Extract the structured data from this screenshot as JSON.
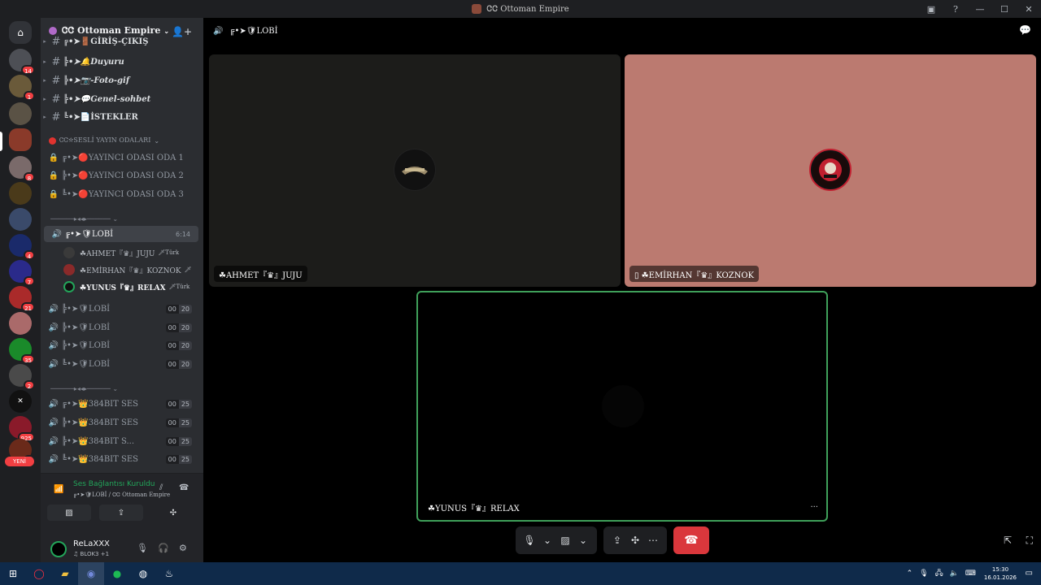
{
  "window": {
    "title": "ᏣᏣ Ottoman Empire",
    "controls": [
      "—",
      "☐",
      "✕"
    ]
  },
  "servers": {
    "badges": [
      "14",
      "1",
      "8",
      "4",
      "7",
      "21",
      "35",
      "2",
      "925",
      "1"
    ],
    "new_label": "YENİ"
  },
  "guild": {
    "name": "ᏣᏣ Ottoman Empire"
  },
  "text_channels": [
    {
      "name": "╔•➤🚪GİRİŞ-ÇIKIŞ"
    },
    {
      "name": "╠•➤🔔Duyuru"
    },
    {
      "name": "╠•➤📷-Foto-gif"
    },
    {
      "name": "╠•➤💬Genel-sohbet"
    },
    {
      "name": "╚•➤📄İSTEKLER"
    }
  ],
  "category_yayin": {
    "name": "ᏣᏣ☆SESLİ YAYIN ODALARI"
  },
  "yayin_channels": [
    {
      "name": "╔•➤🔴YAYINCI ODASI ODA 1"
    },
    {
      "name": "╠•➤🔴YAYINCI ODASI ODA 2"
    },
    {
      "name": "╚•➤🔴YAYINCI ODASI ODA 3"
    }
  ],
  "separator_1": "──────▸◂◂▸────── ⌄",
  "active_channel": {
    "name": "╔•➤🛡LOBİ",
    "timer": "6:14"
  },
  "members": [
    {
      "name": "☘AHMET『♛』JUJU",
      "flag": "🗡Türk"
    },
    {
      "name": "☘EMİRHAN『♛』KOZNOK",
      "flag": "🗡"
    },
    {
      "name": "☘YUNUS『♛』RELAX",
      "flag": "🗡Türk"
    }
  ],
  "lobi_channels": [
    {
      "name": "╠•➤🛡LOBİ",
      "count": "00",
      "limit": "20"
    },
    {
      "name": "╠•➤🛡LOBİ",
      "count": "00",
      "limit": "20"
    },
    {
      "name": "╠•➤🛡LOBİ",
      "count": "00",
      "limit": "20"
    },
    {
      "name": "╚•➤🛡LOBİ",
      "count": "00",
      "limit": "20"
    }
  ],
  "separator_2": "──────▸◂◂▸────── ⌄",
  "bit_channels": [
    {
      "name": "╔•➤👑384BIT SES",
      "count": "00",
      "limit": "25"
    },
    {
      "name": "╠•➤👑384BIT SES",
      "count": "00",
      "limit": "25"
    },
    {
      "name": "╠•➤👑384BIT S...",
      "count": "00",
      "limit": "25"
    },
    {
      "name": "╚•➤👑384BIT SES",
      "count": "00",
      "limit": "25"
    }
  ],
  "voice_panel": {
    "status": "Ses Bağlantısı Kuruldu",
    "location": "╔•➤🛡LOBİ / ᏣᏣ Ottoman Empire"
  },
  "user_panel": {
    "name": "ReLaXXX",
    "status": "♫ BLOK3 +1"
  },
  "call": {
    "header": "╔•➤🛡LOBİ",
    "tiles": [
      {
        "label": "☘AHMET『♛』JUJU"
      },
      {
        "label": "▯ ☘EMİRHAN『♛』KOZNOK"
      },
      {
        "label": "☘YUNUS『♛』RELAX",
        "more": "···"
      }
    ]
  },
  "taskbar": {
    "time": "15:30",
    "date": "16.01.2026"
  },
  "colors": {
    "accent_green": "#23a55a",
    "hangup_red": "#da373c",
    "emirhan_bg": "#bb7a70"
  }
}
